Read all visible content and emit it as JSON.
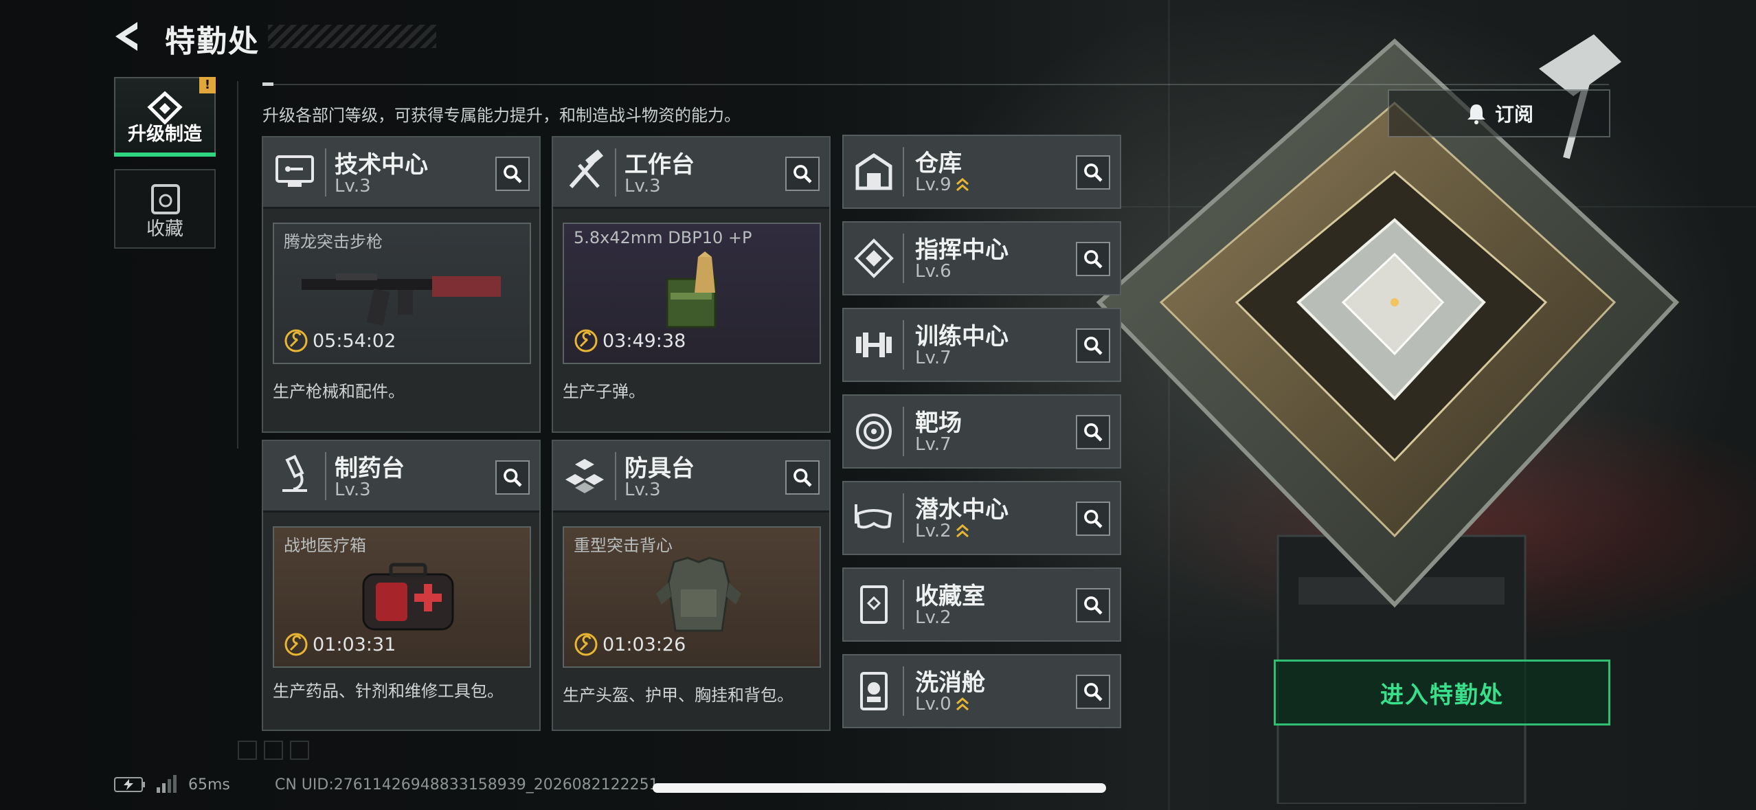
{
  "header": {
    "title": "特勤处"
  },
  "side_tabs": [
    {
      "label": "升级制造",
      "active": true,
      "badge": "!"
    },
    {
      "label": "收藏",
      "active": false
    }
  ],
  "description": "升级各部门等级，可获得专属能力提升，和制造战斗物资的能力。",
  "subscribe_label": "订阅",
  "main_facilities": [
    {
      "name": "技术中心",
      "level": "Lv.3",
      "item": "腾龙突击步枪",
      "timer": "05:54:02",
      "desc": "生产枪械和配件。"
    },
    {
      "name": "工作台",
      "level": "Lv.3",
      "item": "5.8x42mm DBP10 +P",
      "timer": "03:49:38",
      "desc": "生产子弹。"
    },
    {
      "name": "制药台",
      "level": "Lv.3",
      "item": "战地医疗箱",
      "timer": "01:03:31",
      "desc": "生产药品、针剂和维修工具包。"
    },
    {
      "name": "防具台",
      "level": "Lv.3",
      "item": "重型突击背心",
      "timer": "01:03:26",
      "desc": "生产头盔、护甲、胸挂和背包。"
    }
  ],
  "facilities": [
    {
      "name": "仓库",
      "level": "Lv.9",
      "upgradable": true
    },
    {
      "name": "指挥中心",
      "level": "Lv.6",
      "upgradable": false
    },
    {
      "name": "训练中心",
      "level": "Lv.7",
      "upgradable": false
    },
    {
      "name": "靶场",
      "level": "Lv.7",
      "upgradable": false
    },
    {
      "name": "潜水中心",
      "level": "Lv.2",
      "upgradable": true
    },
    {
      "name": "收藏室",
      "level": "Lv.2",
      "upgradable": false
    },
    {
      "name": "洗消舱",
      "level": "Lv.0",
      "upgradable": true
    }
  ],
  "enter_label": "进入特勤处",
  "footer": {
    "ping": "65ms",
    "uid": "CN UID:27611426948833158939_2026082122251"
  },
  "colors": {
    "accent": "#2fd580",
    "warning": "#e2a73b",
    "timer_icon": "#e8b632"
  }
}
